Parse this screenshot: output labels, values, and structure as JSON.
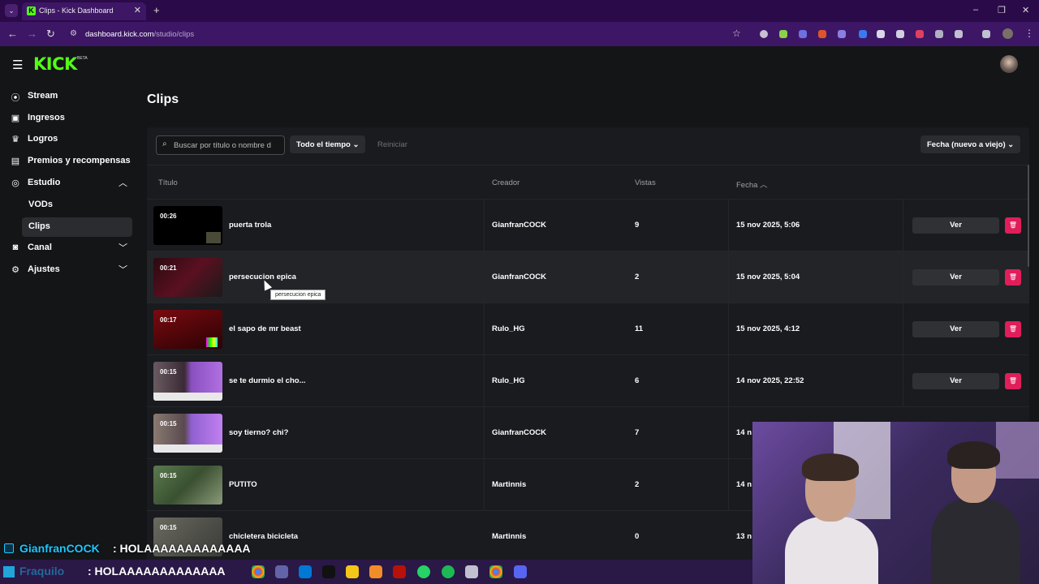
{
  "browser": {
    "tab_title": "Clips - Kick Dashboard",
    "url_host": "dashboard.kick.com",
    "url_path": "/studio/clips"
  },
  "header": {
    "logo_text": "KICK",
    "logo_badge": "BETA"
  },
  "sidebar": {
    "items": [
      {
        "label": "Stream",
        "icon": "stream-icon"
      },
      {
        "label": "Ingresos",
        "icon": "revenue-icon"
      },
      {
        "label": "Logros",
        "icon": "trophy-icon"
      },
      {
        "label": "Premios y recompensas",
        "icon": "rewards-icon"
      },
      {
        "label": "Estudio",
        "icon": "studio-icon"
      },
      {
        "label": "Canal",
        "icon": "channel-icon"
      },
      {
        "label": "Ajustes",
        "icon": "gear-icon"
      }
    ],
    "studio_sub": [
      {
        "label": "VODs"
      },
      {
        "label": "Clips",
        "active": true
      }
    ]
  },
  "main": {
    "title": "Clips",
    "search_placeholder": "Buscar por título o nombre d",
    "time_filter": "Todo el tiempo",
    "reset": "Reiniciar",
    "sort": "Fecha (nuevo a viejo)"
  },
  "table": {
    "headers": {
      "title": "Título",
      "creator": "Creador",
      "views": "Vistas",
      "date": "Fecha"
    },
    "view_label": "Ver",
    "rows": [
      {
        "duration": "00:26",
        "title": "puerta trola",
        "creator": "GianfranCOCK",
        "views": "9",
        "date": "15 nov 2025, 5:06"
      },
      {
        "duration": "00:21",
        "title": "persecucion epica",
        "creator": "GianfranCOCK",
        "views": "2",
        "date": "15 nov 2025, 5:04"
      },
      {
        "duration": "00:17",
        "title": "el sapo de mr beast",
        "creator": "Rulo_HG",
        "views": "11",
        "date": "15 nov 2025, 4:12"
      },
      {
        "duration": "00:15",
        "title": "se te durmio el cho...",
        "creator": "Rulo_HG",
        "views": "6",
        "date": "14 nov 2025, 22:52"
      },
      {
        "duration": "00:15",
        "title": "soy tierno? chi?",
        "creator": "GianfranCOCK",
        "views": "7",
        "date": "14 n"
      },
      {
        "duration": "00:15",
        "title": "PUTITO",
        "creator": "Martinnis",
        "views": "2",
        "date": "14 n"
      },
      {
        "duration": "00:15",
        "title": "chicletera bicicleta",
        "creator": "Martinnis",
        "views": "0",
        "date": "13 n"
      }
    ]
  },
  "tooltip": "persecucion epica",
  "chat": {
    "user": "GianfranCOCK",
    "message": ": HOLAAAAAAAAAAAAA",
    "taskbar_user": "Fraquilo",
    "taskbar_message": ": HOLAAAAAAAAAAAAA"
  },
  "colors": {
    "brand": "#53fc18",
    "danger": "#e01e5a",
    "chat_user": "#1ec8ff"
  }
}
